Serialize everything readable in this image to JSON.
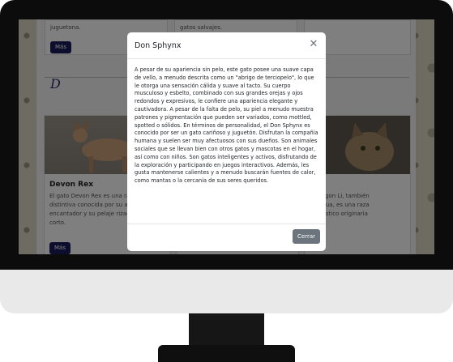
{
  "page": {
    "top_left_card_text": "juguetona.",
    "top_mid_card_text": "gatos salvajes.",
    "mas_label": "Más",
    "section_letter": "D"
  },
  "cards": {
    "devon": {
      "title": "Devon Rex",
      "text_lines": [
        "El gato Devon Rex es una ra",
        "distintiva conocida por su a",
        "encantador y su pelaje rizad",
        "corto."
      ]
    },
    "right": {
      "title_tail": "Li",
      "text_lines": [
        "o Dragon Li, también",
        "o Li Hua, es una raza",
        "doméstico originaria"
      ]
    }
  },
  "modal": {
    "title": "Don Sphynx",
    "close_icon": "close-icon",
    "body": "A pesar de su apariencia sin pelo, este gato posee una suave capa de vello, a menudo descrita como un \"abrigo de terciopelo\", lo que le otorga una sensación cálida y suave al tacto. Su cuerpo musculoso y esbelto, combinado con sus grandes orejas y ojos redondos y expresivos, le confiere una apariencia elegante y cautivadora. A pesar de la falta de pelo, su piel a menudo muestra patrones y pigmentación que pueden ser variados, como mottled, spotted o sólidos. En términos de personalidad, el Don Sphynx es conocido por ser un gato cariñoso y juguetón. Disfrutan la compañía humana y suelen ser muy afectuosos con sus dueños. Son animales sociales que se llevan bien con otros gatos y mascotas en el hogar, así como con niños. Son gatos inteligentes y activos, disfrutando de la exploración y participando en juegos interactivos. Además, les gusta mantenerse calientes y a menudo buscarán fuentes de calor, como mantas o la cercanía de sus seres queridos.",
    "close_button": "Cerrar"
  }
}
